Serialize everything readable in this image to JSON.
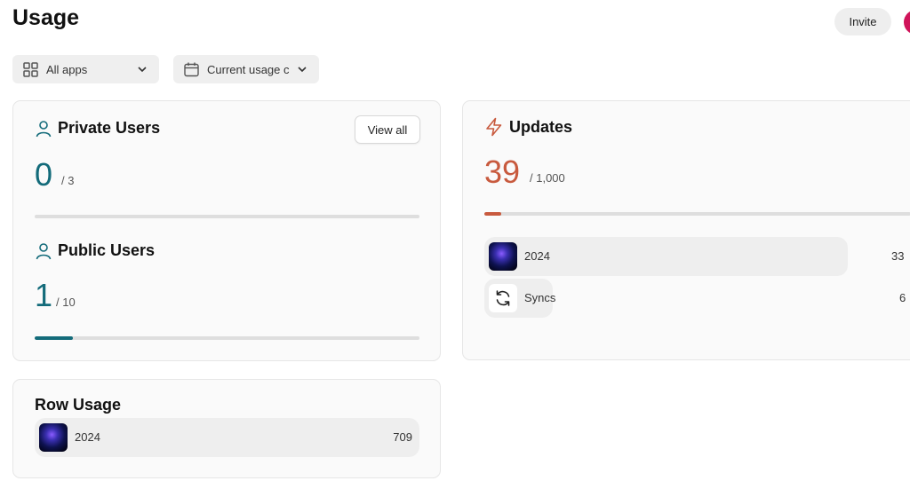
{
  "page": {
    "title": "Usage"
  },
  "header": {
    "invite_label": "Invite"
  },
  "filters": {
    "apps": {
      "label": "All apps"
    },
    "period": {
      "label": "Current usage c"
    }
  },
  "private_users": {
    "title": "Private Users",
    "view_all_label": "View all",
    "value": "0",
    "limit": "/  3",
    "progress_fraction": 0
  },
  "public_users": {
    "title": "Public Users",
    "value": "1",
    "limit": "/  10",
    "progress_fraction": 0.1
  },
  "updates": {
    "title": "Updates",
    "value": "39",
    "limit": "/  1,000",
    "progress_fraction": 0.039,
    "items": [
      {
        "label": "2024",
        "count": "33",
        "icon": "app-thumbnail-galaxy"
      },
      {
        "label": "Syncs",
        "count": "6",
        "icon": "sync-icon"
      }
    ]
  },
  "row_usage": {
    "title": "Row Usage",
    "items": [
      {
        "label": "2024",
        "count": "709",
        "icon": "app-thumbnail-galaxy"
      }
    ]
  },
  "colors": {
    "teal": "#136b7a",
    "orange": "#c85a3e",
    "avatar": "#d0145a"
  }
}
